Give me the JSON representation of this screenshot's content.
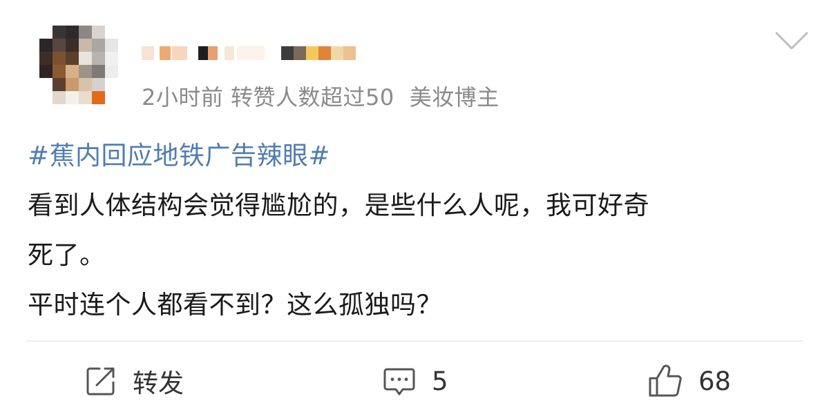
{
  "post": {
    "meta": {
      "time": "2小时前",
      "reposts_note": "转赞人数超过50",
      "tag": "美妆博主"
    },
    "content": {
      "hashtag": "#蕉内回应地铁广告辣眼#",
      "lines": [
        "看到人体结构会觉得尴尬的，是些什么人呢，我可好奇",
        "死了。",
        "平时连个人都看不到？这么孤独吗？"
      ]
    },
    "actions": {
      "repost_label": "转发",
      "comment_count": "5",
      "like_count": "68"
    },
    "icons": {
      "more": "chevron-down-icon",
      "repost": "share-edit-icon",
      "comment": "comment-icon",
      "like": "thumbs-up-icon"
    },
    "colors": {
      "hashtag": "#507daf",
      "meta_text": "#8a8a8a",
      "body_text": "#1a1a1a"
    }
  }
}
